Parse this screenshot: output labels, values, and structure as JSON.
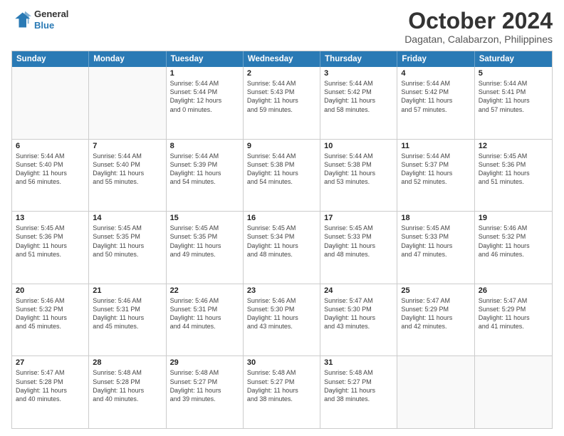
{
  "logo": {
    "general": "General",
    "blue": "Blue"
  },
  "header": {
    "month": "October 2024",
    "location": "Dagatan, Calabarzon, Philippines"
  },
  "weekdays": [
    "Sunday",
    "Monday",
    "Tuesday",
    "Wednesday",
    "Thursday",
    "Friday",
    "Saturday"
  ],
  "weeks": [
    [
      {
        "day": "",
        "detail": ""
      },
      {
        "day": "",
        "detail": ""
      },
      {
        "day": "1",
        "detail": "Sunrise: 5:44 AM\nSunset: 5:44 PM\nDaylight: 12 hours\nand 0 minutes."
      },
      {
        "day": "2",
        "detail": "Sunrise: 5:44 AM\nSunset: 5:43 PM\nDaylight: 11 hours\nand 59 minutes."
      },
      {
        "day": "3",
        "detail": "Sunrise: 5:44 AM\nSunset: 5:42 PM\nDaylight: 11 hours\nand 58 minutes."
      },
      {
        "day": "4",
        "detail": "Sunrise: 5:44 AM\nSunset: 5:42 PM\nDaylight: 11 hours\nand 57 minutes."
      },
      {
        "day": "5",
        "detail": "Sunrise: 5:44 AM\nSunset: 5:41 PM\nDaylight: 11 hours\nand 57 minutes."
      }
    ],
    [
      {
        "day": "6",
        "detail": "Sunrise: 5:44 AM\nSunset: 5:40 PM\nDaylight: 11 hours\nand 56 minutes."
      },
      {
        "day": "7",
        "detail": "Sunrise: 5:44 AM\nSunset: 5:40 PM\nDaylight: 11 hours\nand 55 minutes."
      },
      {
        "day": "8",
        "detail": "Sunrise: 5:44 AM\nSunset: 5:39 PM\nDaylight: 11 hours\nand 54 minutes."
      },
      {
        "day": "9",
        "detail": "Sunrise: 5:44 AM\nSunset: 5:38 PM\nDaylight: 11 hours\nand 54 minutes."
      },
      {
        "day": "10",
        "detail": "Sunrise: 5:44 AM\nSunset: 5:38 PM\nDaylight: 11 hours\nand 53 minutes."
      },
      {
        "day": "11",
        "detail": "Sunrise: 5:44 AM\nSunset: 5:37 PM\nDaylight: 11 hours\nand 52 minutes."
      },
      {
        "day": "12",
        "detail": "Sunrise: 5:45 AM\nSunset: 5:36 PM\nDaylight: 11 hours\nand 51 minutes."
      }
    ],
    [
      {
        "day": "13",
        "detail": "Sunrise: 5:45 AM\nSunset: 5:36 PM\nDaylight: 11 hours\nand 51 minutes."
      },
      {
        "day": "14",
        "detail": "Sunrise: 5:45 AM\nSunset: 5:35 PM\nDaylight: 11 hours\nand 50 minutes."
      },
      {
        "day": "15",
        "detail": "Sunrise: 5:45 AM\nSunset: 5:35 PM\nDaylight: 11 hours\nand 49 minutes."
      },
      {
        "day": "16",
        "detail": "Sunrise: 5:45 AM\nSunset: 5:34 PM\nDaylight: 11 hours\nand 48 minutes."
      },
      {
        "day": "17",
        "detail": "Sunrise: 5:45 AM\nSunset: 5:33 PM\nDaylight: 11 hours\nand 48 minutes."
      },
      {
        "day": "18",
        "detail": "Sunrise: 5:45 AM\nSunset: 5:33 PM\nDaylight: 11 hours\nand 47 minutes."
      },
      {
        "day": "19",
        "detail": "Sunrise: 5:46 AM\nSunset: 5:32 PM\nDaylight: 11 hours\nand 46 minutes."
      }
    ],
    [
      {
        "day": "20",
        "detail": "Sunrise: 5:46 AM\nSunset: 5:32 PM\nDaylight: 11 hours\nand 45 minutes."
      },
      {
        "day": "21",
        "detail": "Sunrise: 5:46 AM\nSunset: 5:31 PM\nDaylight: 11 hours\nand 45 minutes."
      },
      {
        "day": "22",
        "detail": "Sunrise: 5:46 AM\nSunset: 5:31 PM\nDaylight: 11 hours\nand 44 minutes."
      },
      {
        "day": "23",
        "detail": "Sunrise: 5:46 AM\nSunset: 5:30 PM\nDaylight: 11 hours\nand 43 minutes."
      },
      {
        "day": "24",
        "detail": "Sunrise: 5:47 AM\nSunset: 5:30 PM\nDaylight: 11 hours\nand 43 minutes."
      },
      {
        "day": "25",
        "detail": "Sunrise: 5:47 AM\nSunset: 5:29 PM\nDaylight: 11 hours\nand 42 minutes."
      },
      {
        "day": "26",
        "detail": "Sunrise: 5:47 AM\nSunset: 5:29 PM\nDaylight: 11 hours\nand 41 minutes."
      }
    ],
    [
      {
        "day": "27",
        "detail": "Sunrise: 5:47 AM\nSunset: 5:28 PM\nDaylight: 11 hours\nand 40 minutes."
      },
      {
        "day": "28",
        "detail": "Sunrise: 5:48 AM\nSunset: 5:28 PM\nDaylight: 11 hours\nand 40 minutes."
      },
      {
        "day": "29",
        "detail": "Sunrise: 5:48 AM\nSunset: 5:27 PM\nDaylight: 11 hours\nand 39 minutes."
      },
      {
        "day": "30",
        "detail": "Sunrise: 5:48 AM\nSunset: 5:27 PM\nDaylight: 11 hours\nand 38 minutes."
      },
      {
        "day": "31",
        "detail": "Sunrise: 5:48 AM\nSunset: 5:27 PM\nDaylight: 11 hours\nand 38 minutes."
      },
      {
        "day": "",
        "detail": ""
      },
      {
        "day": "",
        "detail": ""
      }
    ]
  ]
}
